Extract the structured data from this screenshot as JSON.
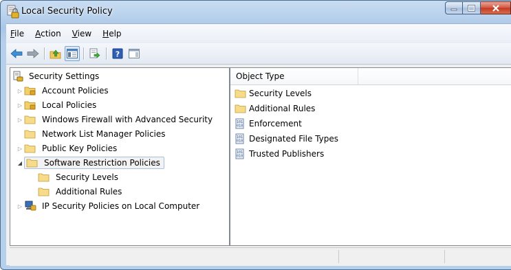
{
  "window": {
    "title": "Local Security Policy"
  },
  "menubar": {
    "items": [
      {
        "accel": "F",
        "rest": "ile"
      },
      {
        "accel": "A",
        "rest": "ction"
      },
      {
        "accel": "V",
        "rest": "iew"
      },
      {
        "accel": "H",
        "rest": "elp"
      }
    ]
  },
  "toolbar": {
    "buttons": [
      "back-icon",
      "forward-icon",
      "up-one-level-icon",
      "show-hide-console-tree-icon",
      "export-list-icon",
      "help-icon",
      "show-hide-action-pane-icon"
    ]
  },
  "tree": {
    "root": "Security Settings",
    "items": [
      {
        "label": "Account Policies"
      },
      {
        "label": "Local Policies"
      },
      {
        "label": "Windows Firewall with Advanced Security"
      },
      {
        "label": "Network List Manager Policies"
      },
      {
        "label": "Public Key Policies"
      },
      {
        "label": "Software Restriction Policies"
      },
      {
        "label": "Security Levels"
      },
      {
        "label": "Additional Rules"
      },
      {
        "label": "IP Security Policies on Local Computer"
      }
    ]
  },
  "list": {
    "header": "Object Type",
    "rows": [
      {
        "label": "Security Levels",
        "icon": "folder-icon"
      },
      {
        "label": "Additional Rules",
        "icon": "folder-icon"
      },
      {
        "label": "Enforcement",
        "icon": "binary-policy-icon"
      },
      {
        "label": "Designated File Types",
        "icon": "binary-policy-icon"
      },
      {
        "label": "Trusted Publishers",
        "icon": "binary-policy-icon"
      }
    ]
  }
}
